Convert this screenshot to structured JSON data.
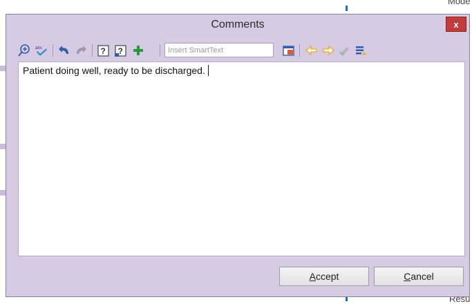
{
  "background": {
    "top_text": "Mode",
    "bottom_text": "Resu"
  },
  "dialog": {
    "title": "Comments",
    "close_label": "x"
  },
  "toolbar": {
    "items": [
      {
        "name": "zoom-in-icon"
      },
      {
        "name": "spellcheck-icon"
      },
      {
        "name": "undo-icon"
      },
      {
        "name": "redo-icon"
      },
      {
        "name": "help-icon"
      },
      {
        "name": "help-next-icon"
      },
      {
        "name": "add-icon"
      },
      {
        "name": "smarttext-browse-icon"
      },
      {
        "name": "arrow-left-icon"
      },
      {
        "name": "arrow-right-icon"
      },
      {
        "name": "sign-icon"
      },
      {
        "name": "insert-list-icon"
      }
    ],
    "smarttext_placeholder": "Insert SmartText"
  },
  "editor": {
    "text": "Patient doing well, ready to be discharged."
  },
  "buttons": {
    "accept_first": "A",
    "accept_rest": "ccept",
    "cancel_first": "C",
    "cancel_rest": "ancel"
  },
  "colors": {
    "dialog_bg": "#d7cbe3",
    "close_red": "#c23b3b",
    "accent_green": "#2a9a3a",
    "accent_yellow": "#e8b23a",
    "icon_blue": "#2f5fa8"
  }
}
